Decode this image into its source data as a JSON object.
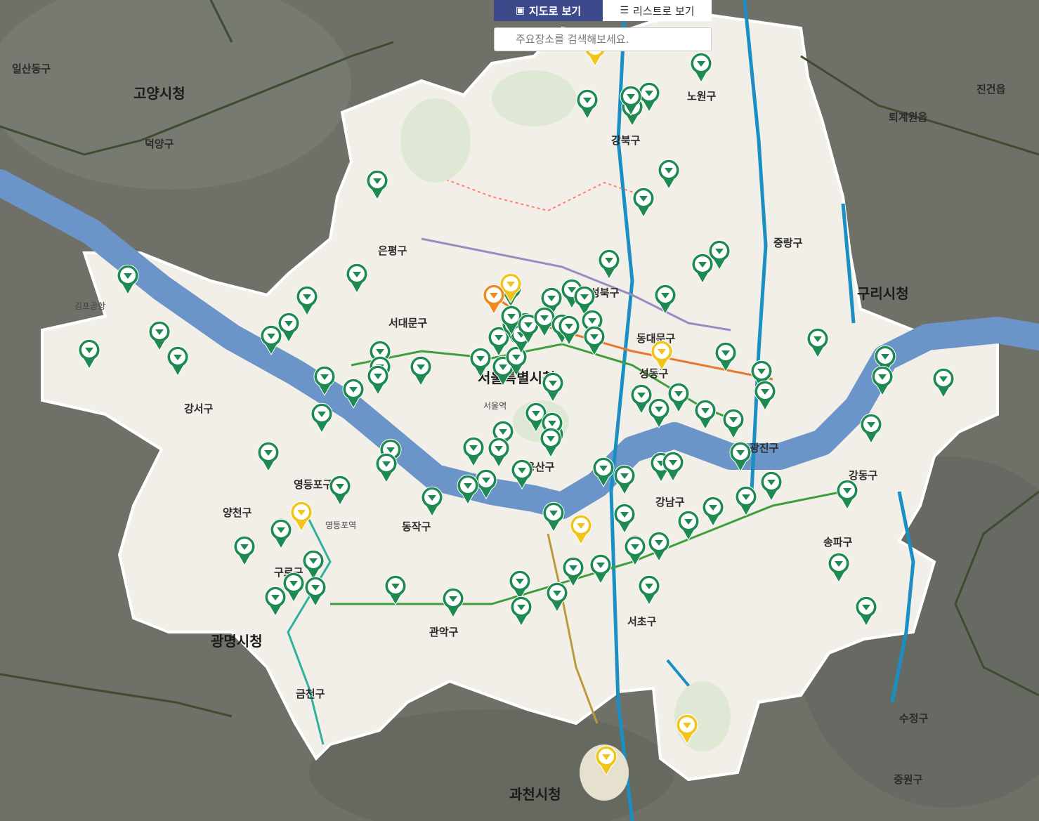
{
  "toggle": {
    "map_label": "지도로 보기",
    "list_label": "리스트로 보기"
  },
  "search": {
    "placeholder": "주요장소를 검색해보세요."
  },
  "colors": {
    "active_tab": "#3c4a8c",
    "marker_green": "#1e8a52",
    "marker_yellow": "#f2c417",
    "marker_orange": "#f08a1c",
    "river": "#6b95c8",
    "seoul_area": "#f2efe8",
    "outside_area": "#6f7068"
  },
  "labels": {
    "seoul_city_hall": "서울특별시청",
    "goyang": "고양시청",
    "gwangmyeong": "광명시청",
    "guri": "구리시청",
    "gwacheon": "과천시청",
    "eunpyeong": "은평구",
    "seodaemun": "서대문구",
    "gangseo": "강서구",
    "yangcheon": "양천구",
    "yeongdeungpo": "영등포구",
    "dongjak": "동작구",
    "gwanak": "관악구",
    "geumcheon": "금천구",
    "guro": "구로구",
    "seocho": "서초구",
    "gangnam": "강남구",
    "songpa": "송파구",
    "gangdong": "강동구",
    "gwangjin": "광진구",
    "seongdong": "성동구",
    "dongdaemun": "동대문구",
    "jungnang": "중랑구",
    "seongbuk": "성북구",
    "gangbuk": "강북구",
    "nowon": "노원구",
    "yongsan": "용산구",
    "seoul_station": "서울역",
    "yeongdeungpo_station": "영등포역",
    "gimpo_airport": "김포공항",
    "ilsan": "일산동구",
    "deogyang": "덕양구",
    "sujeong": "수정구",
    "jungwon": "중원구",
    "jinggeon": "진건읍",
    "toegyewon": "퇴계원읍"
  },
  "markers": {
    "green_count": 104,
    "yellow_count": 7,
    "orange_count": 1
  }
}
